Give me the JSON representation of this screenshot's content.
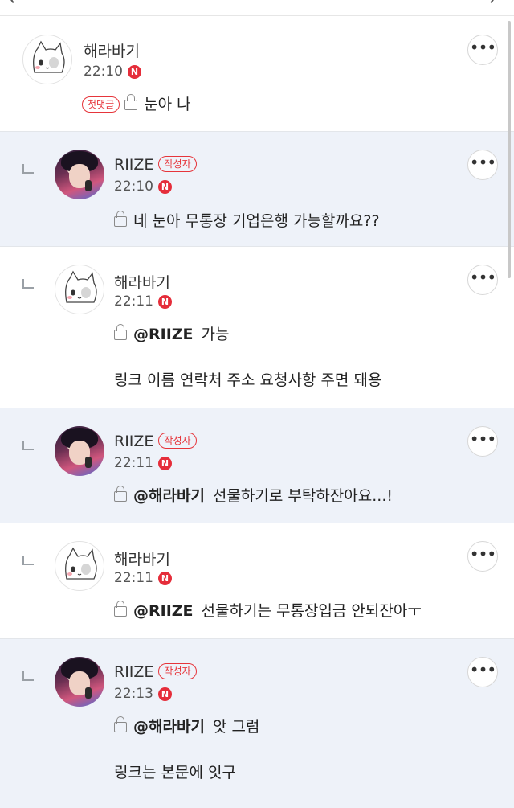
{
  "accent_color": "#e52d3a",
  "icons": [
    "reply-arrow-icon",
    "lock-icon",
    "more-icon",
    "n-badge-icon"
  ],
  "comments": [
    {
      "nickname": "해라바기",
      "time": "22:10",
      "new_badge": "N",
      "first_badge": "첫댓글",
      "text": "눈아 나"
    },
    {
      "nickname": "RIIZE",
      "author_badge": "작성자",
      "time": "22:10",
      "new_badge": "N",
      "text": "네 눈아 무통장 기업은행 가능할까요??"
    },
    {
      "nickname": "해라바기",
      "time": "22:11",
      "new_badge": "N",
      "mention": "@RIIZE",
      "text": "가능",
      "text2": "링크 이름 연락처 주소 요청사항 주면 돼용"
    },
    {
      "nickname": "RIIZE",
      "author_badge": "작성자",
      "time": "22:11",
      "new_badge": "N",
      "mention": "@해라바기",
      "text": "선물하기로 부탁하잔아요...!"
    },
    {
      "nickname": "해라바기",
      "time": "22:11",
      "new_badge": "N",
      "mention": "@RIIZE",
      "text": "선물하기는 무통장입금 안되잔아ㅜ"
    },
    {
      "nickname": "RIIZE",
      "author_badge": "작성자",
      "time": "22:13",
      "new_badge": "N",
      "mention": "@해라바기",
      "text": "앗 그럼",
      "text2": "링크는 본문에 잇구"
    }
  ]
}
